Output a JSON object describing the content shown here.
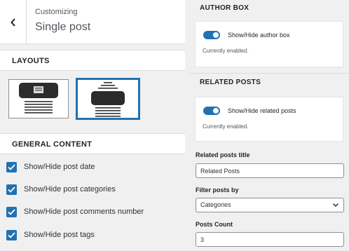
{
  "header": {
    "breadcrumb": "Customizing",
    "title": "Single post"
  },
  "sections": {
    "layouts": "LAYOUTS",
    "general_content": "GENERAL CONTENT"
  },
  "layouts": {
    "options": [
      "layout-image-top",
      "layout-image-middle"
    ],
    "selected_index": 1
  },
  "general_content": {
    "items": [
      {
        "label": "Show/Hide post date",
        "checked": true
      },
      {
        "label": "Show/Hide post categories",
        "checked": true
      },
      {
        "label": "Show/Hide post comments number",
        "checked": true
      },
      {
        "label": "Show/Hide post tags",
        "checked": true
      }
    ]
  },
  "author_box": {
    "heading": "AUTHOR BOX",
    "toggle_label": "Show/Hide author box",
    "status": "Currently enabled.",
    "enabled": true
  },
  "related_posts": {
    "heading": "RELATED POSTS",
    "toggle_label": "Show/Hide related posts",
    "status": "Currently enabled.",
    "enabled": true,
    "title_label": "Related posts title",
    "title_value": "Related Posts",
    "filter_label": "Filter posts by",
    "filter_value": "Categories",
    "count_label": "Posts Count",
    "count_value": "3"
  },
  "colors": {
    "accent": "#2271b1",
    "panel_bg": "#f0f0f1"
  },
  "icons": {
    "back": "chevron-left-icon",
    "checkbox": "checkmark-icon",
    "select": "chevron-down-icon"
  }
}
